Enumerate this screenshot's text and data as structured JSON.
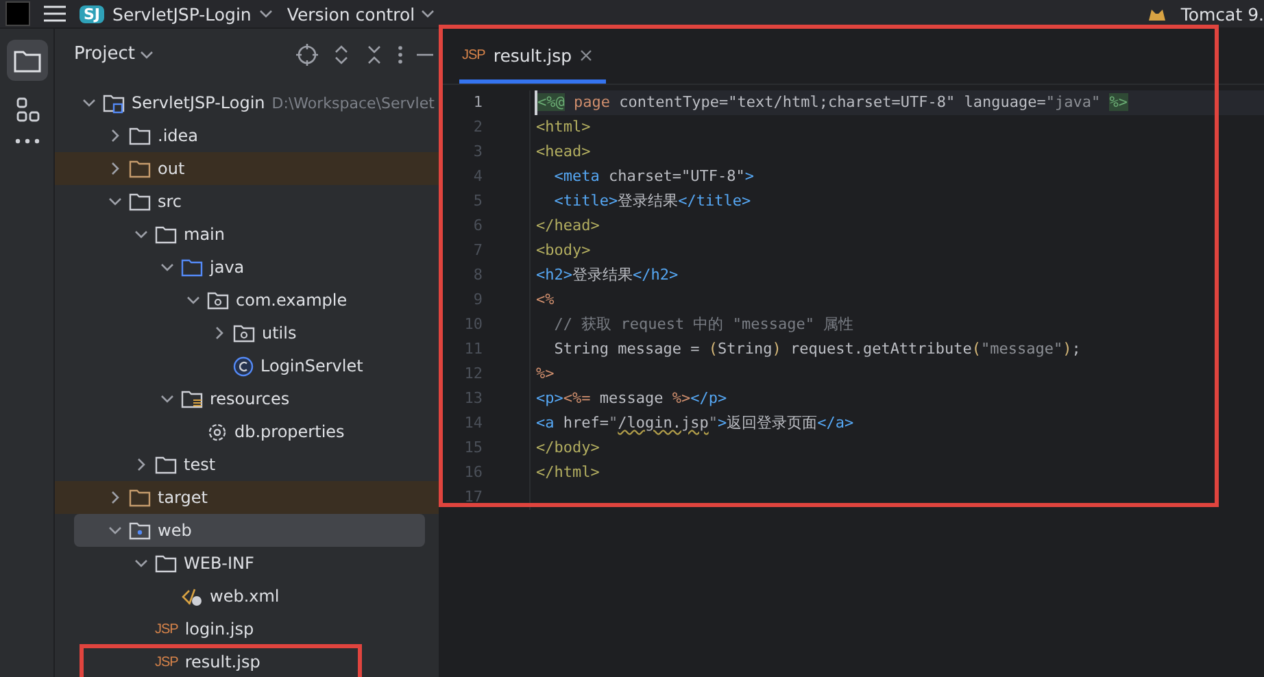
{
  "top_bar": {
    "project_badge": "SJ",
    "project_name": "ServletJSP-Login",
    "vcs": "Version control",
    "run_config": "Tomcat 9."
  },
  "project_panel": {
    "title": "Project",
    "tree": [
      {
        "label": "ServletJSP-Login",
        "kind": "project",
        "path": "D:\\Workspace\\Servlet",
        "expanded": true,
        "selected": false,
        "excluded": false,
        "children": [
          {
            "label": ".idea",
            "kind": "folder",
            "expanded": false,
            "selected": false,
            "excluded": false
          },
          {
            "label": "out",
            "kind": "folder-excluded",
            "expanded": false,
            "selected": false,
            "excluded": true
          },
          {
            "label": "src",
            "kind": "folder",
            "expanded": true,
            "selected": false,
            "excluded": false,
            "children": [
              {
                "label": "main",
                "kind": "folder",
                "expanded": true,
                "selected": false,
                "excluded": false,
                "children": [
                  {
                    "label": "java",
                    "kind": "folder-source",
                    "expanded": true,
                    "selected": false,
                    "excluded": false,
                    "children": [
                      {
                        "label": "com.example",
                        "kind": "package",
                        "expanded": true,
                        "selected": false,
                        "excluded": false,
                        "children": [
                          {
                            "label": "utils",
                            "kind": "package",
                            "expanded": false,
                            "selected": false,
                            "excluded": false
                          },
                          {
                            "label": "LoginServlet",
                            "kind": "class",
                            "selected": false,
                            "excluded": false
                          }
                        ]
                      }
                    ]
                  },
                  {
                    "label": "resources",
                    "kind": "resources",
                    "expanded": true,
                    "selected": false,
                    "excluded": false,
                    "children": [
                      {
                        "label": "db.properties",
                        "kind": "settings",
                        "selected": false,
                        "excluded": false
                      }
                    ]
                  }
                ]
              },
              {
                "label": "test",
                "kind": "folder",
                "expanded": false,
                "selected": false,
                "excluded": false
              }
            ]
          },
          {
            "label": "target",
            "kind": "folder-excluded",
            "expanded": false,
            "selected": false,
            "excluded": true
          },
          {
            "label": "web",
            "kind": "folder-web",
            "expanded": true,
            "selected": true,
            "excluded": false,
            "children": [
              {
                "label": "WEB-INF",
                "kind": "folder",
                "expanded": true,
                "selected": false,
                "excluded": false,
                "children": [
                  {
                    "label": "web.xml",
                    "kind": "xml",
                    "selected": false,
                    "excluded": false
                  }
                ]
              },
              {
                "label": "login.jsp",
                "kind": "jsp",
                "icon_text": "JSP",
                "selected": false,
                "excluded": false
              },
              {
                "label": "result.jsp",
                "kind": "jsp",
                "icon_text": "JSP",
                "selected": false,
                "excluded": false,
                "highlighted": true
              }
            ]
          }
        ]
      }
    ]
  },
  "editor": {
    "highlighted": true,
    "tabs": [
      {
        "label": "result.jsp",
        "kind": "jsp",
        "icon_text": "JSP",
        "selected": true
      }
    ],
    "lines": [
      {
        "number": "1",
        "current": true,
        "tokens": [
          {
            "text": "<%@",
            "kind": "delim"
          },
          {
            "text": " page",
            "kind": "keyword"
          },
          {
            "text": " contentType=",
            "kind": "plain"
          },
          {
            "text": "\"text/html;charset=UTF-8\"",
            "kind": "plain"
          },
          {
            "text": " language=",
            "kind": "plain"
          },
          {
            "text": "\"java\" ",
            "kind": "string"
          },
          {
            "text": "%>",
            "kind": "delim"
          }
        ]
      },
      {
        "number": "2",
        "current": false,
        "tokens": [
          {
            "text": "<html>",
            "kind": "tag"
          }
        ]
      },
      {
        "number": "3",
        "current": false,
        "tokens": [
          {
            "text": "<head>",
            "kind": "tag"
          }
        ]
      },
      {
        "number": "4",
        "current": false,
        "tokens": [
          {
            "text": "  <meta",
            "kind": "tag2"
          },
          {
            "text": " charset=",
            "kind": "plain"
          },
          {
            "text": "\"UTF-8\"",
            "kind": "plain"
          },
          {
            "text": ">",
            "kind": "tag2"
          }
        ]
      },
      {
        "number": "5",
        "current": false,
        "tokens": [
          {
            "text": "  <title>",
            "kind": "tag2"
          },
          {
            "text": "登录结果",
            "kind": "plain"
          },
          {
            "text": "</title>",
            "kind": "tag2"
          }
        ]
      },
      {
        "number": "6",
        "current": false,
        "tokens": [
          {
            "text": "</head>",
            "kind": "tag"
          }
        ]
      },
      {
        "number": "7",
        "current": false,
        "tokens": [
          {
            "text": "<body>",
            "kind": "tag"
          }
        ]
      },
      {
        "number": "8",
        "current": false,
        "tokens": [
          {
            "text": "<h2>",
            "kind": "tag2"
          },
          {
            "text": "登录结果",
            "kind": "plain"
          },
          {
            "text": "</h2>",
            "kind": "tag2"
          }
        ]
      },
      {
        "number": "9",
        "current": false,
        "tokens": [
          {
            "text": "<%",
            "kind": "scriptlet"
          }
        ]
      },
      {
        "number": "10",
        "current": false,
        "tokens": [
          {
            "text": "  // 获取 request 中的 \"message\" 属性",
            "kind": "comment"
          }
        ]
      },
      {
        "number": "11",
        "current": false,
        "tokens": [
          {
            "text": "  String message = ",
            "kind": "plain"
          },
          {
            "text": "(",
            "kind": "paren"
          },
          {
            "text": "String",
            "kind": "plain"
          },
          {
            "text": ")",
            "kind": "paren"
          },
          {
            "text": " request.getAttribute",
            "kind": "plain"
          },
          {
            "text": "(",
            "kind": "paren"
          },
          {
            "text": "\"message\"",
            "kind": "string"
          },
          {
            "text": ")",
            "kind": "paren"
          },
          {
            "text": ";",
            "kind": "plain"
          }
        ]
      },
      {
        "number": "12",
        "current": false,
        "tokens": [
          {
            "text": "%>",
            "kind": "scriptlet"
          }
        ]
      },
      {
        "number": "13",
        "current": false,
        "tokens": [
          {
            "text": "<p>",
            "kind": "tag2"
          },
          {
            "text": "<%=",
            "kind": "scriptlet"
          },
          {
            "text": " message ",
            "kind": "plain"
          },
          {
            "text": "%>",
            "kind": "scriptlet"
          },
          {
            "text": "</p>",
            "kind": "tag2"
          }
        ]
      },
      {
        "number": "14",
        "current": false,
        "tokens": [
          {
            "text": "<a",
            "kind": "tag2"
          },
          {
            "text": " href=",
            "kind": "plain"
          },
          {
            "text": "\"",
            "kind": "string"
          },
          {
            "text": "/login.jsp",
            "kind": "link"
          },
          {
            "text": "\"",
            "kind": "string"
          },
          {
            "text": ">",
            "kind": "tag2"
          },
          {
            "text": "返回登录页面",
            "kind": "plain"
          },
          {
            "text": "</a>",
            "kind": "tag2"
          }
        ]
      },
      {
        "number": "15",
        "current": false,
        "tokens": [
          {
            "text": "</body>",
            "kind": "tag"
          }
        ]
      },
      {
        "number": "16",
        "current": false,
        "tokens": [
          {
            "text": "</html>",
            "kind": "tag"
          }
        ]
      },
      {
        "number": "17",
        "current": false
      }
    ]
  }
}
